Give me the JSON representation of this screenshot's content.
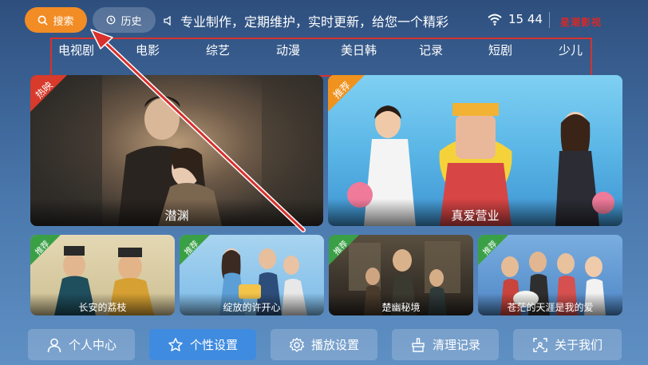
{
  "top_bar": {
    "search_label": "搜索",
    "history_label": "历史",
    "ticker_text": "专业制作，定期维护，实时更新，给您一个精彩",
    "time": "15 44",
    "brand": "星潮影视"
  },
  "nav": {
    "items": [
      "电视剧",
      "电影",
      "综艺",
      "动漫",
      "美日韩",
      "记录",
      "短剧",
      "少儿"
    ]
  },
  "featured": [
    {
      "title": "潜渊",
      "badge": "热映",
      "badge_color": "#d83a2b"
    },
    {
      "title": "真爱营业",
      "badge": "推荐",
      "badge_color": "#f0921e"
    }
  ],
  "recommended": [
    {
      "title": "长安的荔枝",
      "badge": "推荐",
      "badge_color": "#3aa046"
    },
    {
      "title": "绽放的许开心",
      "badge": "推荐",
      "badge_color": "#3aa046"
    },
    {
      "title": "楚幽秘境",
      "badge": "推荐",
      "badge_color": "#3aa046"
    },
    {
      "title": "苍茫的天涯是我的爱",
      "badge": "推荐",
      "badge_color": "#3aa046"
    }
  ],
  "bottom": {
    "items": [
      "个人中心",
      "个性设置",
      "播放设置",
      "清理记录",
      "关于我们"
    ]
  },
  "colors": {
    "accent_orange": "#f28c25",
    "annotation_red": "#d8312d",
    "active_blue": "#3f8be0"
  },
  "icons": {
    "search": "search-icon",
    "history": "clock-icon",
    "speaker": "speaker-icon",
    "wifi": "wifi-icon",
    "user": "user-icon",
    "star": "star-icon",
    "settings": "gear-icon",
    "clean": "broom-icon",
    "about": "info-icon"
  }
}
